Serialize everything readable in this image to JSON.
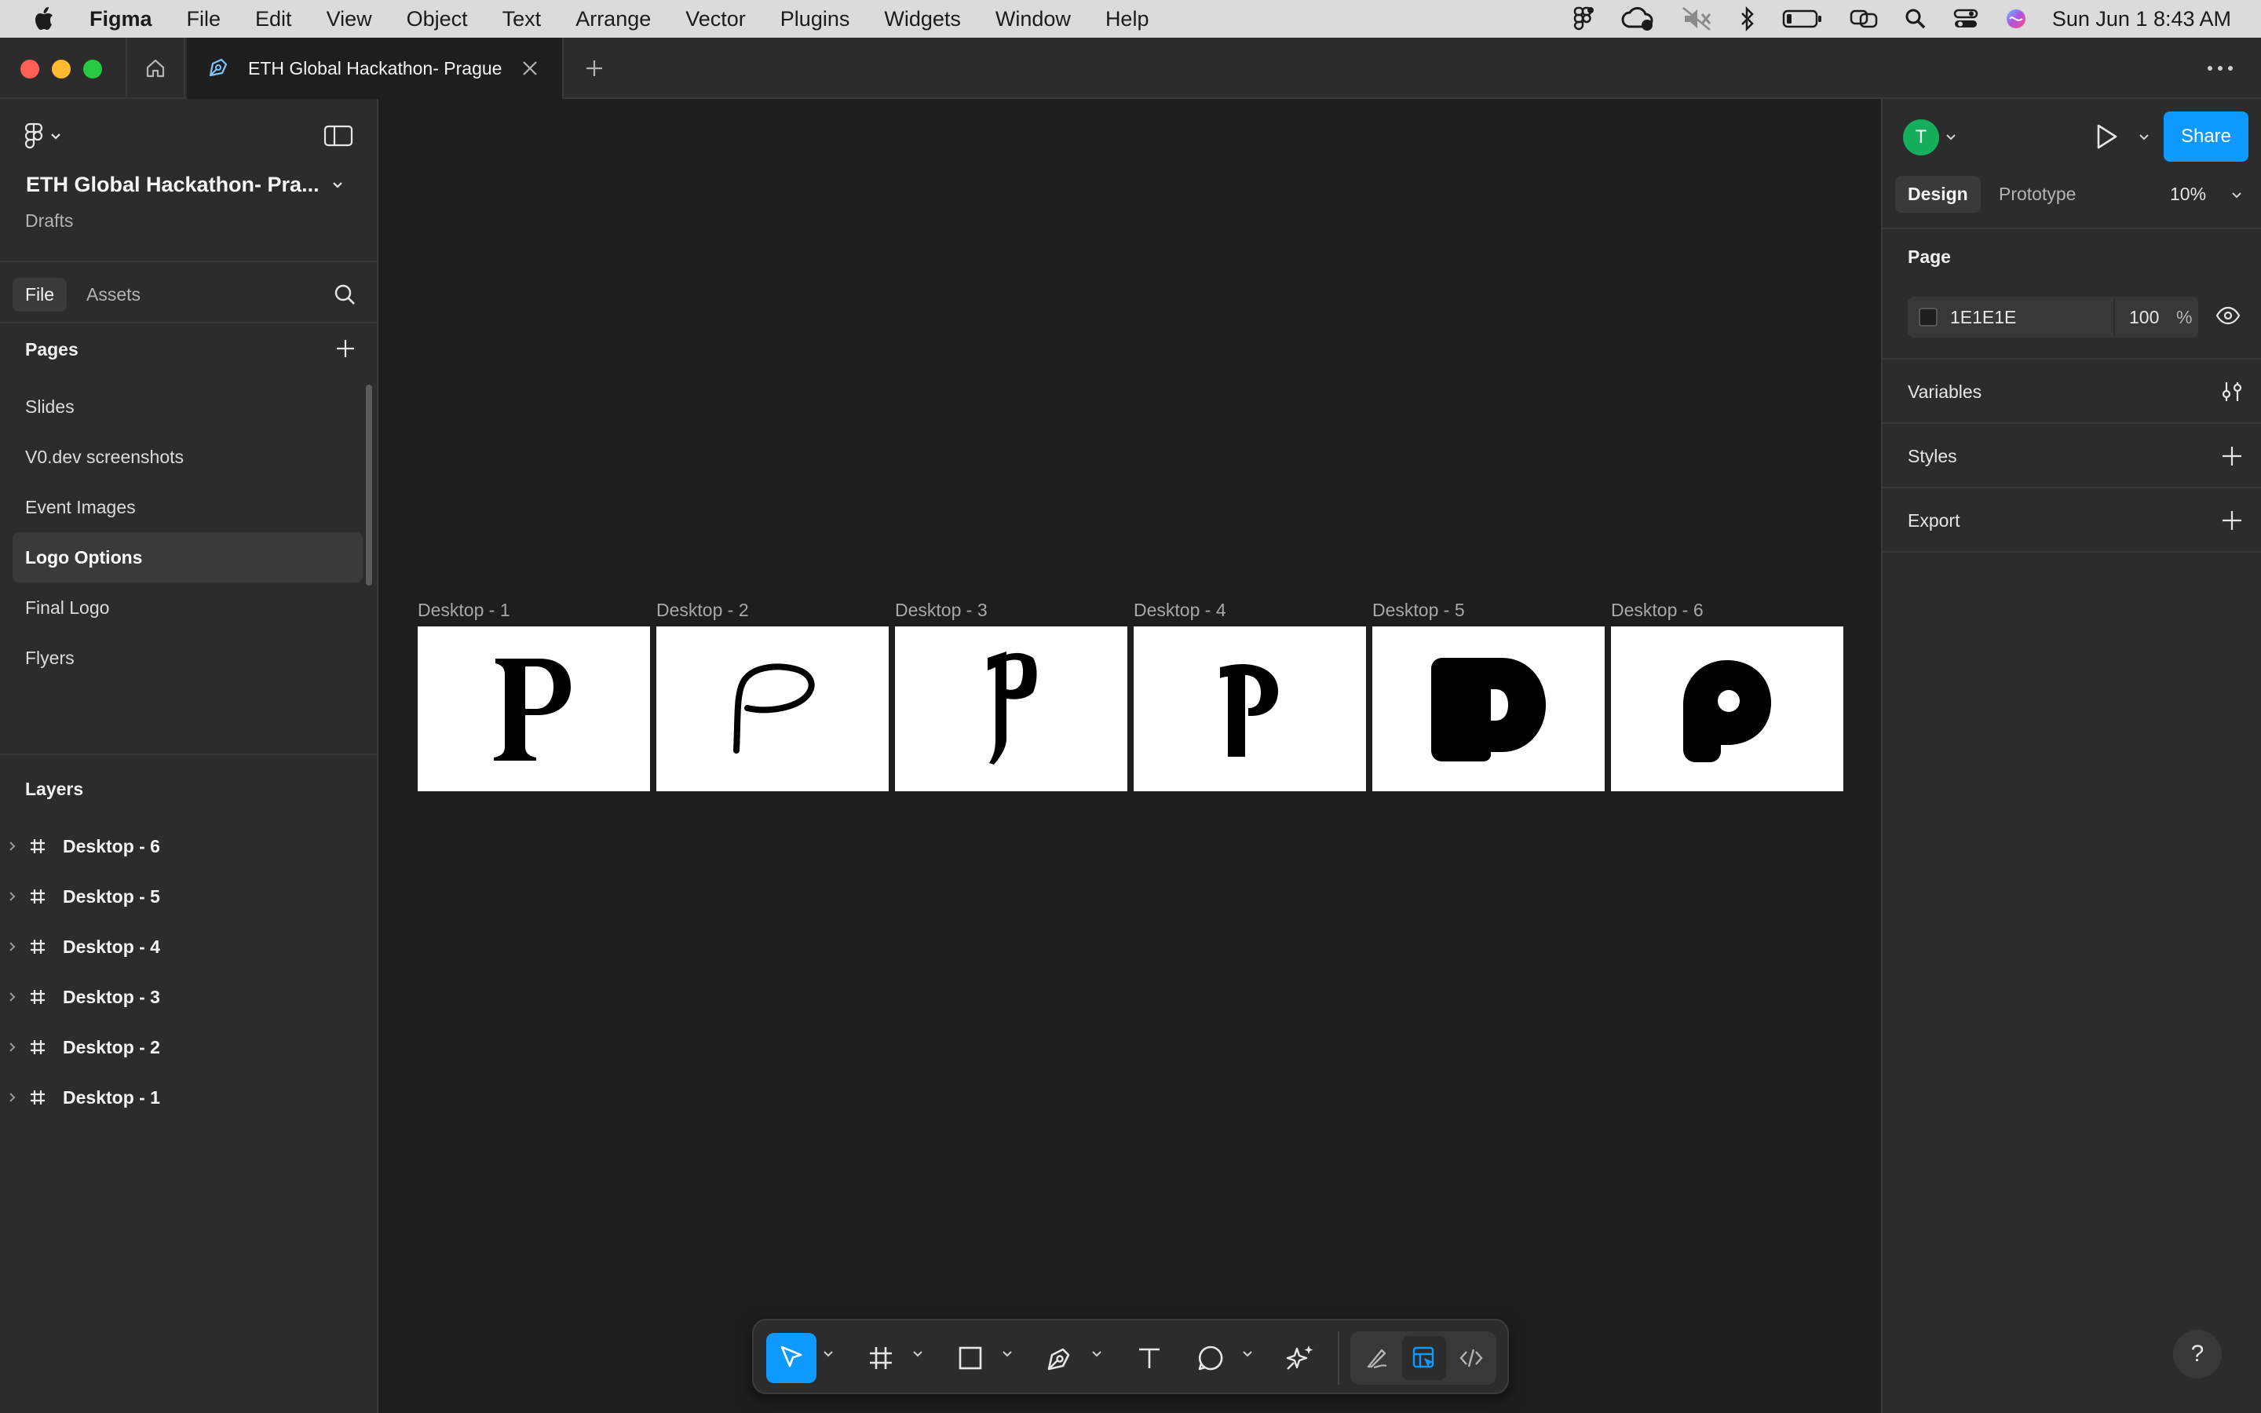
{
  "menubar": {
    "app_name": "Figma",
    "menus": [
      "File",
      "Edit",
      "View",
      "Object",
      "Text",
      "Arrange",
      "Vector",
      "Plugins",
      "Widgets",
      "Window",
      "Help"
    ],
    "clock": "Sun Jun 1  8:43 AM"
  },
  "tabbar": {
    "document_tab_title": "ETH Global Hackathon- Prague"
  },
  "left_panel": {
    "file_name": "ETH Global Hackathon- Pra...",
    "file_location": "Drafts",
    "tabs": [
      "File",
      "Assets"
    ],
    "pages_heading": "Pages",
    "pages": [
      {
        "label": "Slides",
        "active": false
      },
      {
        "label": "V0.dev screenshots",
        "active": false
      },
      {
        "label": "Event Images",
        "active": false
      },
      {
        "label": "Logo Options",
        "active": true
      },
      {
        "label": "Final Logo",
        "active": false
      },
      {
        "label": "Flyers",
        "active": false
      }
    ],
    "layers_heading": "Layers",
    "layers": [
      "Desktop - 6",
      "Desktop - 5",
      "Desktop - 4",
      "Desktop - 3",
      "Desktop - 2",
      "Desktop - 1"
    ]
  },
  "canvas": {
    "frames": [
      {
        "label": "Desktop - 1",
        "glyph": "serif-p-logo"
      },
      {
        "label": "Desktop - 2",
        "glyph": "script-p-logo"
      },
      {
        "label": "Desktop - 3",
        "glyph": "blackletter-p-logo"
      },
      {
        "label": "Desktop - 4",
        "glyph": "curly-p-logo"
      },
      {
        "label": "Desktop - 5",
        "glyph": "block-p-logo"
      },
      {
        "label": "Desktop - 6",
        "glyph": "round-p-logo"
      }
    ]
  },
  "toolbar": {
    "tools": [
      "move-tool",
      "frame-tool",
      "rectangle-tool",
      "pen-tool",
      "text-tool",
      "comment-tool",
      "actions-tool"
    ],
    "active_tool": "move-tool",
    "modes": [
      "draw-mode",
      "design-mode",
      "dev-mode"
    ],
    "active_mode": "design-mode"
  },
  "right_panel": {
    "avatar_initial": "T",
    "share_label": "Share",
    "tabs": [
      "Design",
      "Prototype"
    ],
    "zoom": "10%",
    "page_section": {
      "title": "Page",
      "color_hex": "1E1E1E",
      "opacity": "100",
      "opacity_unit": "%"
    },
    "variables_title": "Variables",
    "styles_title": "Styles",
    "export_title": "Export",
    "help_label": "?"
  },
  "colors": {
    "accent": "#0d99ff",
    "avatar": "#14ae5c",
    "canvas_bg": "#1e1e1e",
    "panel_bg": "#2c2c2c",
    "traffic_close": "#ff5f57",
    "traffic_min": "#febc2e",
    "traffic_max": "#28c840"
  }
}
